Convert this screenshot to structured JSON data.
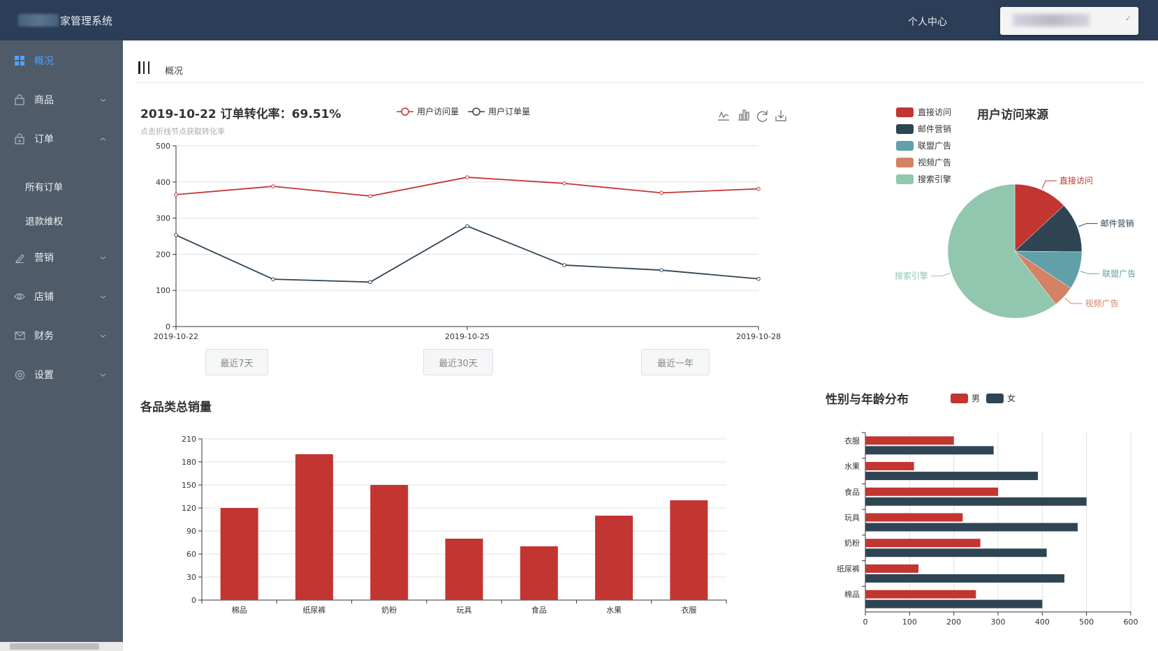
{
  "header": {
    "brand_text": "家管理系统",
    "personal_center": "个人中心"
  },
  "sidebar": {
    "items": [
      {
        "label": "概况",
        "icon": "grid-icon",
        "active": true
      },
      {
        "label": "商品",
        "icon": "bag-icon"
      },
      {
        "label": "订单",
        "icon": "order-icon",
        "expanded": true
      },
      {
        "label": "营销",
        "icon": "pen-icon"
      },
      {
        "label": "店铺",
        "icon": "eye-icon"
      },
      {
        "label": "财务",
        "icon": "mail-icon"
      },
      {
        "label": "设置",
        "icon": "gear-icon"
      }
    ],
    "order_sub_items": [
      "所有订单",
      "退款维权"
    ]
  },
  "breadcrumb": {
    "current": "概况"
  },
  "colors": {
    "header_bg": "#2c3e57",
    "sidebar_bg": "#4f5b69",
    "active": "#4ea3f5",
    "red": "#c23531",
    "navy": "#2f4554",
    "teal": "#61a0a8",
    "orange": "#d48265",
    "green": "#91c7ae"
  },
  "range_buttons": [
    "最近7天",
    "最近30天",
    "最近一年"
  ],
  "chart_data": [
    {
      "type": "line",
      "title": "2019-10-22  订单转化率：69.51%",
      "subtitle": "点击折线节点获取转化率",
      "x_labels": [
        "2019-10-22",
        "2019-10-25",
        "2019-10-28"
      ],
      "ylim": [
        0,
        500
      ],
      "y_ticks": [
        0,
        100,
        200,
        300,
        400,
        500
      ],
      "legend": [
        "用户访问量",
        "用户订单量"
      ],
      "series": [
        {
          "name": "用户访问量",
          "values": [
            365,
            388,
            361,
            413,
            396,
            370,
            381
          ]
        },
        {
          "name": "用户订单量",
          "values": [
            253,
            131,
            123,
            278,
            170,
            156,
            132
          ]
        }
      ],
      "toolbox": [
        "line-chart-icon",
        "bar-chart-icon",
        "refresh-icon",
        "download-icon"
      ]
    },
    {
      "type": "pie",
      "title": "用户访问来源",
      "legend": [
        "直接访问",
        "邮件营销",
        "联盟广告",
        "视频广告",
        "搜索引擎"
      ],
      "values": [
        335,
        310,
        234,
        135,
        1548
      ]
    },
    {
      "type": "bar",
      "title": "各品类总销量",
      "categories": [
        "棉品",
        "纸尿裤",
        "奶粉",
        "玩具",
        "食品",
        "水果",
        "衣服"
      ],
      "values": [
        120,
        190,
        150,
        80,
        70,
        110,
        130
      ],
      "ylim": [
        0,
        210
      ],
      "y_ticks": [
        0,
        30,
        60,
        90,
        120,
        150,
        180,
        210
      ]
    },
    {
      "type": "bar",
      "orientation": "horizontal",
      "title": "性别与年龄分布",
      "categories": [
        "衣服",
        "水果",
        "食品",
        "玩具",
        "奶粉",
        "纸尿裤",
        "棉品"
      ],
      "legend": [
        "男",
        "女"
      ],
      "series": [
        {
          "name": "男",
          "values": [
            200,
            110,
            300,
            220,
            260,
            120,
            250
          ]
        },
        {
          "name": "女",
          "values": [
            290,
            390,
            500,
            480,
            410,
            450,
            400
          ]
        }
      ],
      "xlim": [
        0,
        600
      ],
      "x_ticks": [
        0,
        100,
        200,
        300,
        400,
        500,
        600
      ]
    }
  ]
}
